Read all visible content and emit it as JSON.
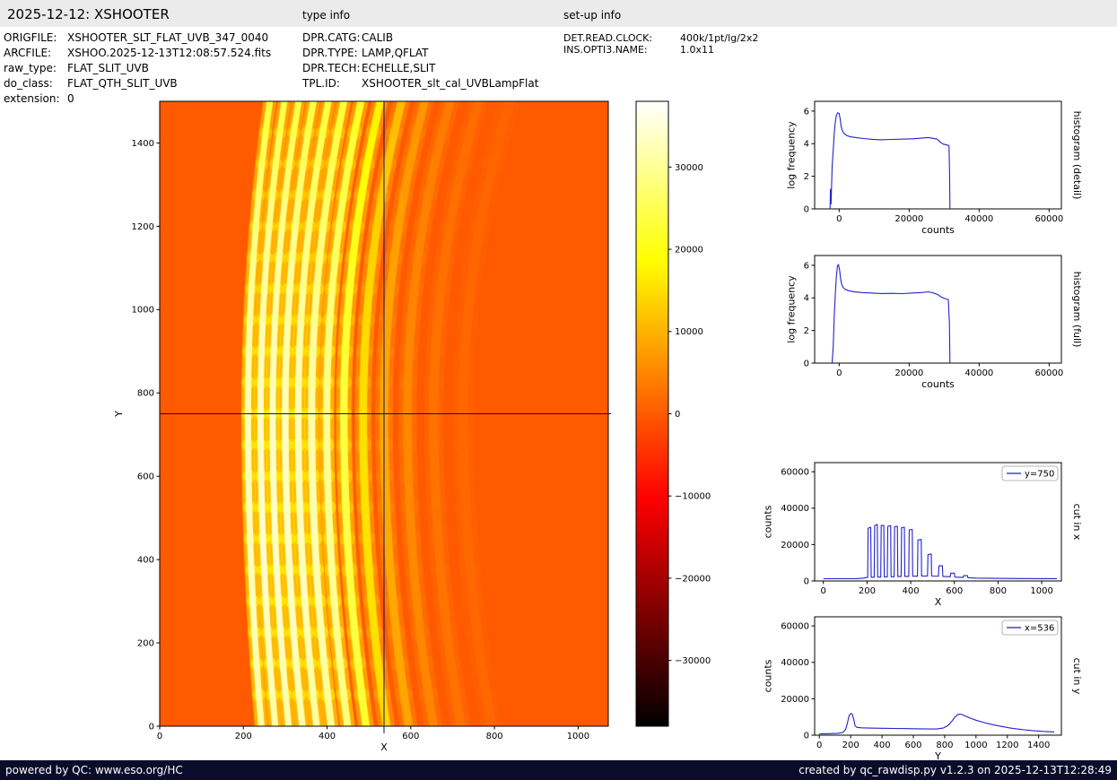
{
  "header": {
    "title": "2025-12-12: XSHOOTER",
    "type_info_label": "type info",
    "setup_info_label": "set-up info"
  },
  "metadata": {
    "left": [
      {
        "label": "ORIGFILE:",
        "value": "XSHOOTER_SLT_FLAT_UVB_347_0040"
      },
      {
        "label": "ARCFILE:",
        "value": "XSHOO.2025-12-13T12:08:57.524.fits"
      },
      {
        "label": "raw_type:",
        "value": "FLAT_SLIT_UVB"
      },
      {
        "label": "do_class:",
        "value": "FLAT_QTH_SLIT_UVB"
      },
      {
        "label": "extension:",
        "value": "0"
      }
    ],
    "type_info": [
      {
        "label": "DPR.CATG:",
        "value": "CALIB"
      },
      {
        "label": "DPR.TYPE:",
        "value": "LAMP,QFLAT"
      },
      {
        "label": "DPR.TECH:",
        "value": "ECHELLE,SLIT"
      },
      {
        "label": "TPL.ID:",
        "value": "XSHOOTER_slt_cal_UVBLampFlat"
      }
    ],
    "setup_info": [
      {
        "label": "DET.READ.CLOCK:",
        "value": "400k/1pt/lg/2x2"
      },
      {
        "label": "INS.OPTI3.NAME:",
        "value": "1.0x11"
      }
    ]
  },
  "footer": {
    "left": "powered by QC: www.eso.org/HC",
    "right": "created by qc_rawdisp.py v1.2.3 on 2025-12-13T12:28:49"
  },
  "colors": {
    "header_bg": "#ebebeb",
    "footer_bg": "#0b0b2a",
    "footer_text": "#ffffff",
    "plot_line": "#2222cc",
    "crosshair": "#10106e",
    "axis": "#000000"
  },
  "chart_data": [
    {
      "id": "raw_image",
      "type": "heatmap",
      "xlabel": "X",
      "ylabel": "Y",
      "xlim": [
        0,
        1072
      ],
      "ylim": [
        0,
        1500
      ],
      "xticks": [
        0,
        200,
        400,
        600,
        800,
        1000
      ],
      "yticks": [
        0,
        200,
        400,
        600,
        800,
        1000,
        1200,
        1400
      ],
      "crosshair": {
        "x": 536,
        "y": 750
      },
      "colormap": "hot",
      "value_range": [
        -38000,
        38000
      ],
      "colorbar_ticks": [
        30000,
        20000,
        10000,
        0,
        -10000,
        -20000,
        -30000
      ],
      "curvature": {
        "bottom_dx": 32,
        "top_dx": 52
      },
      "orders": [
        {
          "x_mid": 211,
          "width": 15,
          "peak": 33000
        },
        {
          "x_mid": 241,
          "width": 15,
          "peak": 34000
        },
        {
          "x_mid": 270,
          "width": 15,
          "peak": 34000
        },
        {
          "x_mid": 300,
          "width": 16,
          "peak": 33500
        },
        {
          "x_mid": 331,
          "width": 16,
          "peak": 33000
        },
        {
          "x_mid": 363,
          "width": 17,
          "peak": 32000
        },
        {
          "x_mid": 399,
          "width": 17,
          "peak": 30000
        },
        {
          "x_mid": 440,
          "width": 18,
          "peak": 24000
        },
        {
          "x_mid": 486,
          "width": 19,
          "peak": 15500
        },
        {
          "x_mid": 536,
          "width": 20,
          "peak": 9000
        },
        {
          "x_mid": 592,
          "width": 21,
          "peak": 5200
        },
        {
          "x_mid": 655,
          "width": 22,
          "peak": 2800
        },
        {
          "x_mid": 725,
          "width": 24,
          "peak": 1500
        }
      ]
    },
    {
      "id": "hist_detail",
      "type": "line",
      "xlabel": "counts",
      "ylabel": "log frequency",
      "right_label": "histogram (detail)",
      "xlim": [
        -7000,
        63500
      ],
      "ylim": [
        0,
        6.6
      ],
      "xticks": [
        0,
        20000,
        40000,
        60000
      ],
      "yticks": [
        0,
        2,
        4,
        6
      ],
      "points": [
        [
          -2600,
          0
        ],
        [
          -2500,
          1.2
        ],
        [
          -2300,
          0.3
        ],
        [
          -2000,
          2.6
        ],
        [
          -1700,
          3.6
        ],
        [
          -1400,
          4.6
        ],
        [
          -1100,
          5.3
        ],
        [
          -800,
          5.75
        ],
        [
          -400,
          5.9
        ],
        [
          0,
          5.85
        ],
        [
          300,
          5.5
        ],
        [
          600,
          5.05
        ],
        [
          900,
          4.8
        ],
        [
          1400,
          4.62
        ],
        [
          2200,
          4.5
        ],
        [
          3200,
          4.42
        ],
        [
          4800,
          4.38
        ],
        [
          7000,
          4.32
        ],
        [
          9500,
          4.27
        ],
        [
          12000,
          4.24
        ],
        [
          15000,
          4.26
        ],
        [
          18000,
          4.28
        ],
        [
          21000,
          4.3
        ],
        [
          23500,
          4.34
        ],
        [
          25500,
          4.38
        ],
        [
          26800,
          4.33
        ],
        [
          28000,
          4.28
        ],
        [
          29000,
          4.08
        ],
        [
          29800,
          3.97
        ],
        [
          30800,
          3.92
        ],
        [
          31400,
          3.88
        ],
        [
          31550,
          2.2
        ],
        [
          31650,
          0
        ]
      ]
    },
    {
      "id": "hist_full",
      "type": "line",
      "xlabel": "counts",
      "ylabel": "log frequency",
      "right_label": "histogram (full)",
      "xlim": [
        -7000,
        63500
      ],
      "ylim": [
        0,
        6.6
      ],
      "xticks": [
        0,
        20000,
        40000,
        60000
      ],
      "yticks": [
        0,
        2,
        4,
        6
      ],
      "points": [
        [
          -2000,
          0
        ],
        [
          -1700,
          1.0
        ],
        [
          -1400,
          2.8
        ],
        [
          -1100,
          4.2
        ],
        [
          -800,
          5.3
        ],
        [
          -500,
          5.95
        ],
        [
          -200,
          6.05
        ],
        [
          100,
          5.75
        ],
        [
          400,
          5.2
        ],
        [
          700,
          4.85
        ],
        [
          1100,
          4.65
        ],
        [
          1800,
          4.52
        ],
        [
          2800,
          4.44
        ],
        [
          4200,
          4.38
        ],
        [
          6500,
          4.33
        ],
        [
          9000,
          4.3
        ],
        [
          12000,
          4.27
        ],
        [
          15000,
          4.28
        ],
        [
          18000,
          4.26
        ],
        [
          21000,
          4.3
        ],
        [
          23500,
          4.33
        ],
        [
          25500,
          4.37
        ],
        [
          27000,
          4.3
        ],
        [
          28200,
          4.2
        ],
        [
          29200,
          4.05
        ],
        [
          30200,
          3.96
        ],
        [
          31200,
          3.9
        ],
        [
          31500,
          2.5
        ],
        [
          31650,
          0
        ]
      ]
    },
    {
      "id": "cut_x",
      "type": "line",
      "xlabel": "X",
      "ylabel": "counts",
      "right_label": "cut in x",
      "legend": "y=750",
      "xlim": [
        -40,
        1090
      ],
      "ylim": [
        0,
        65000
      ],
      "xticks": [
        0,
        200,
        400,
        600,
        800,
        1000
      ],
      "yticks": [
        0,
        20000,
        40000,
        60000
      ],
      "points": [
        [
          0,
          1250
        ],
        [
          100,
          1250
        ],
        [
          150,
          1300
        ],
        [
          180,
          1550
        ],
        [
          203,
          2000
        ],
        [
          205,
          29000
        ],
        [
          217,
          29500
        ],
        [
          219,
          2000
        ],
        [
          233,
          2000
        ],
        [
          235,
          30500
        ],
        [
          247,
          31000
        ],
        [
          249,
          2100
        ],
        [
          263,
          2100
        ],
        [
          265,
          30500
        ],
        [
          277,
          30500
        ],
        [
          279,
          2200
        ],
        [
          293,
          2200
        ],
        [
          295,
          30000
        ],
        [
          308,
          30500
        ],
        [
          310,
          2300
        ],
        [
          324,
          2300
        ],
        [
          326,
          29800
        ],
        [
          339,
          30000
        ],
        [
          341,
          2400
        ],
        [
          356,
          2400
        ],
        [
          358,
          29300
        ],
        [
          371,
          29500
        ],
        [
          373,
          2500
        ],
        [
          391,
          2500
        ],
        [
          393,
          28000
        ],
        [
          407,
          28300
        ],
        [
          409,
          2600
        ],
        [
          431,
          2600
        ],
        [
          433,
          22500
        ],
        [
          448,
          22800
        ],
        [
          450,
          2700
        ],
        [
          477,
          2700
        ],
        [
          479,
          14500
        ],
        [
          494,
          14800
        ],
        [
          496,
          2700
        ],
        [
          527,
          2600
        ],
        [
          529,
          8300
        ],
        [
          545,
          8300
        ],
        [
          547,
          2500
        ],
        [
          581,
          2300
        ],
        [
          583,
          4300
        ],
        [
          600,
          4300
        ],
        [
          602,
          2100
        ],
        [
          640,
          1900
        ],
        [
          642,
          2900
        ],
        [
          660,
          2900
        ],
        [
          662,
          1800
        ],
        [
          700,
          1600
        ],
        [
          780,
          1450
        ],
        [
          900,
          1350
        ],
        [
          1000,
          1300
        ],
        [
          1070,
          1280
        ]
      ]
    },
    {
      "id": "cut_y",
      "type": "line",
      "xlabel": "Y",
      "ylabel": "counts",
      "right_label": "cut in y",
      "legend": "x=536",
      "xlim": [
        -30,
        1545
      ],
      "ylim": [
        0,
        65000
      ],
      "xticks": [
        0,
        200,
        400,
        600,
        800,
        1000,
        1200,
        1400
      ],
      "yticks": [
        0,
        20000,
        40000,
        60000
      ],
      "points": [
        [
          0,
          700
        ],
        [
          60,
          820
        ],
        [
          120,
          1050
        ],
        [
          150,
          1500
        ],
        [
          168,
          3200
        ],
        [
          180,
          7000
        ],
        [
          190,
          10800
        ],
        [
          200,
          11900
        ],
        [
          210,
          11600
        ],
        [
          220,
          8500
        ],
        [
          228,
          5200
        ],
        [
          240,
          4300
        ],
        [
          270,
          4050
        ],
        [
          320,
          3900
        ],
        [
          400,
          3780
        ],
        [
          480,
          3680
        ],
        [
          560,
          3580
        ],
        [
          640,
          3480
        ],
        [
          700,
          3420
        ],
        [
          750,
          3420
        ],
        [
          790,
          3900
        ],
        [
          820,
          5200
        ],
        [
          845,
          7600
        ],
        [
          865,
          9900
        ],
        [
          882,
          11200
        ],
        [
          897,
          11600
        ],
        [
          912,
          11300
        ],
        [
          935,
          10400
        ],
        [
          965,
          9300
        ],
        [
          1000,
          8200
        ],
        [
          1045,
          7100
        ],
        [
          1095,
          6000
        ],
        [
          1150,
          5000
        ],
        [
          1220,
          3900
        ],
        [
          1290,
          3100
        ],
        [
          1360,
          2500
        ],
        [
          1430,
          2050
        ],
        [
          1500,
          1750
        ]
      ]
    }
  ]
}
